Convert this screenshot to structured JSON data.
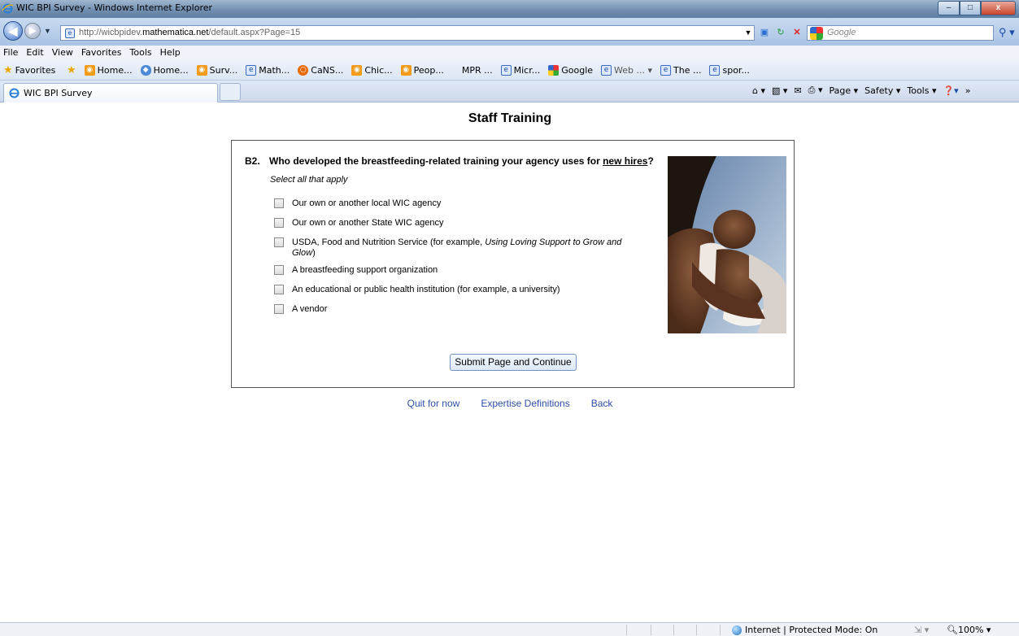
{
  "window": {
    "title": "WIC BPI Survey - Windows Internet Explorer",
    "controls": {
      "minimize": "–",
      "maximize": "□",
      "close": "x"
    }
  },
  "address_bar": {
    "url_prefix": "http://wicbpidev.",
    "url_host": "mathematica.net",
    "url_suffix": "/default.aspx?Page=15",
    "search_placeholder": "Google"
  },
  "menu": [
    "File",
    "Edit",
    "View",
    "Favorites",
    "Tools",
    "Help"
  ],
  "favorites": {
    "label": "Favorites",
    "links": [
      "Home...",
      "Home...",
      "Surv...",
      "Math...",
      "CaNS...",
      "Chic...",
      "Peop...",
      "MPR ...",
      "Micr...",
      "Google",
      "Web ... ▾",
      "The ...",
      "spor..."
    ]
  },
  "tab": {
    "label": "WIC BPI Survey"
  },
  "command_bar": {
    "page": "Page ▾",
    "safety": "Safety ▾",
    "tools": "Tools ▾"
  },
  "survey": {
    "page_title": "Staff Training",
    "question_number": "B2.",
    "question_text_before": "Who developed the breastfeeding-related training your agency uses for ",
    "question_text_underlined": "new hires",
    "question_text_after": "?",
    "instruction": "Select all that apply",
    "options": [
      "Our own or another local WIC agency",
      "Our own or another State WIC agency",
      "USDA, Food and Nutrition Service (for example, ",
      "A breastfeeding support organization",
      "An educational or public health institution (for example, a university)",
      "A vendor"
    ],
    "option3_italic": "Using Loving Support to Grow and Glow",
    "option3_end": ")",
    "submit_label": "Submit Page and Continue",
    "footer_links": [
      "Quit for now",
      "Expertise Definitions",
      "Back"
    ]
  },
  "status_bar": {
    "zone_text": "Internet | Protected Mode: On",
    "zoom": "100%"
  }
}
